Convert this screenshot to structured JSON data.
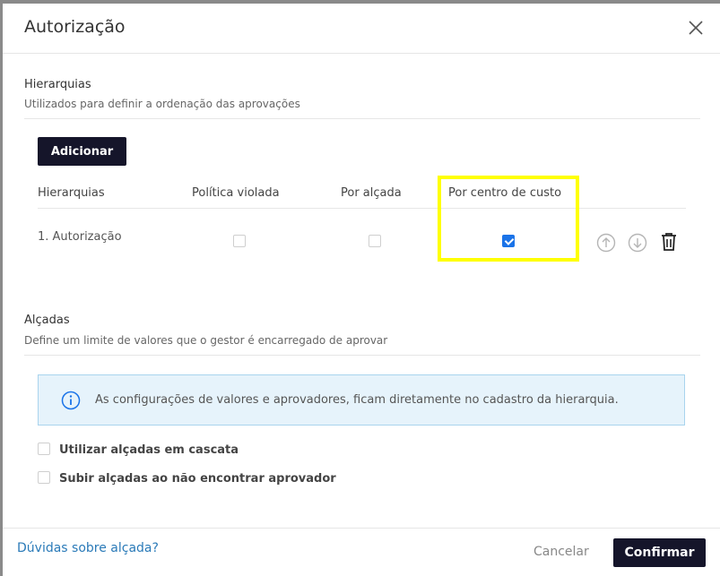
{
  "dialog": {
    "title": "Autorização",
    "close_icon": "close-icon"
  },
  "hierarquias": {
    "title": "Hierarquias",
    "subtitle": "Utilizados para definir a ordenação das aprovações",
    "add_button": "Adicionar",
    "columns": [
      "Hierarquias",
      "Política violada",
      "Por alçada",
      "Por centro de custo"
    ],
    "rows": [
      {
        "name": "1. Autorização",
        "politica_violada": false,
        "por_alcada": false,
        "por_centro_de_custo": true,
        "actions": [
          "arrow-up-circle-icon",
          "arrow-down-circle-icon",
          "trash-icon"
        ]
      }
    ]
  },
  "alcadas": {
    "title": "Alçadas",
    "subtitle": "Define um limite de valores que o gestor é encarregado de aprovar",
    "info_icon": "info-icon",
    "info_text": "As configurações de valores e aprovadores, ficam diretamente no cadastro da hierarquia.",
    "options": [
      {
        "label": "Utilizar alçadas em cascata",
        "checked": false
      },
      {
        "label": "Subir alçadas ao não encontrar aprovador",
        "checked": false
      }
    ]
  },
  "footer": {
    "help_link": "Dúvidas sobre alçada?",
    "cancel_label": "Cancelar",
    "confirm_label": "Confirmar"
  },
  "colors": {
    "primary_dark": "#15152a",
    "checkbox_checked": "#1a73e8",
    "highlight": "#ffff00",
    "info_bg": "#e6f3fb",
    "link": "#2a7ab8"
  }
}
